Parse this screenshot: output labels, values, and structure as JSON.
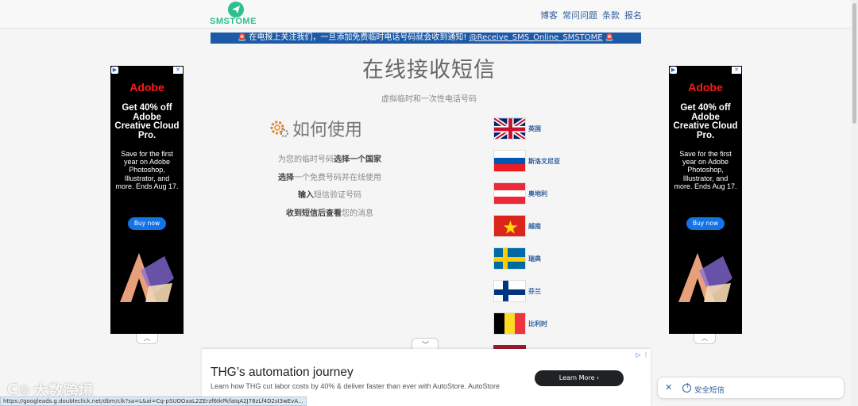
{
  "header": {
    "logo_text": "SMSTOME",
    "nav": [
      "博客",
      "常问问题",
      "条款",
      "报名"
    ]
  },
  "notice": {
    "text": "在电报上关注我们，一旦添加免费临时电话号码就会收到通知!",
    "handle": "@Receive_SMS_Online_SMSTOME"
  },
  "hero": {
    "title": "在线接收短信",
    "subtitle": "虚拟临时和一次性电话号码"
  },
  "howto": {
    "title": "如何使用",
    "icon": "gear-icon",
    "steps": [
      {
        "pre": "为您的临时号码",
        "bold": "选择一个国家",
        "post": ""
      },
      {
        "pre": "",
        "bold": "选择",
        "post": "一个免费号码并在线使用"
      },
      {
        "pre": "",
        "bold": "输入",
        "post": "短信验证号码"
      },
      {
        "pre": "",
        "bold": "收到短信后查看",
        "post": "您的消息"
      }
    ]
  },
  "countries": [
    {
      "name": "英国",
      "flag": "uk"
    },
    {
      "name": "斯洛文尼亚",
      "flag": "si"
    },
    {
      "name": "奥地利",
      "flag": "at"
    },
    {
      "name": "越南",
      "flag": "vn"
    },
    {
      "name": "瑞典",
      "flag": "se"
    },
    {
      "name": "芬兰",
      "flag": "fi"
    },
    {
      "name": "比利时",
      "flag": "be"
    }
  ],
  "side_ad": {
    "brand": "Adobe",
    "promo": "Get 40% off Adobe Creative Cloud Pro.",
    "desc": "Save for the first year on Adobe Photoshop, Illustrator, and more. Ends Aug 17.",
    "cta": "Buy now"
  },
  "bottom_ad": {
    "title": "THG’s automation journey",
    "desc": "Learn how THG cut labor costs by 40% & deliver faster than ever with AutoStore. AutoStore",
    "cta": "Learn More"
  },
  "safe_pill": {
    "label": "安全短信"
  },
  "watermark": "大数跨境",
  "status_url": "https://googleads.g.doubleclick.net/dbm/clk?sa=L&ai=Cq-pSUOOaaL2ZErzf6tkPkfaIqA2J78zLf4D2sI3wEvA..."
}
